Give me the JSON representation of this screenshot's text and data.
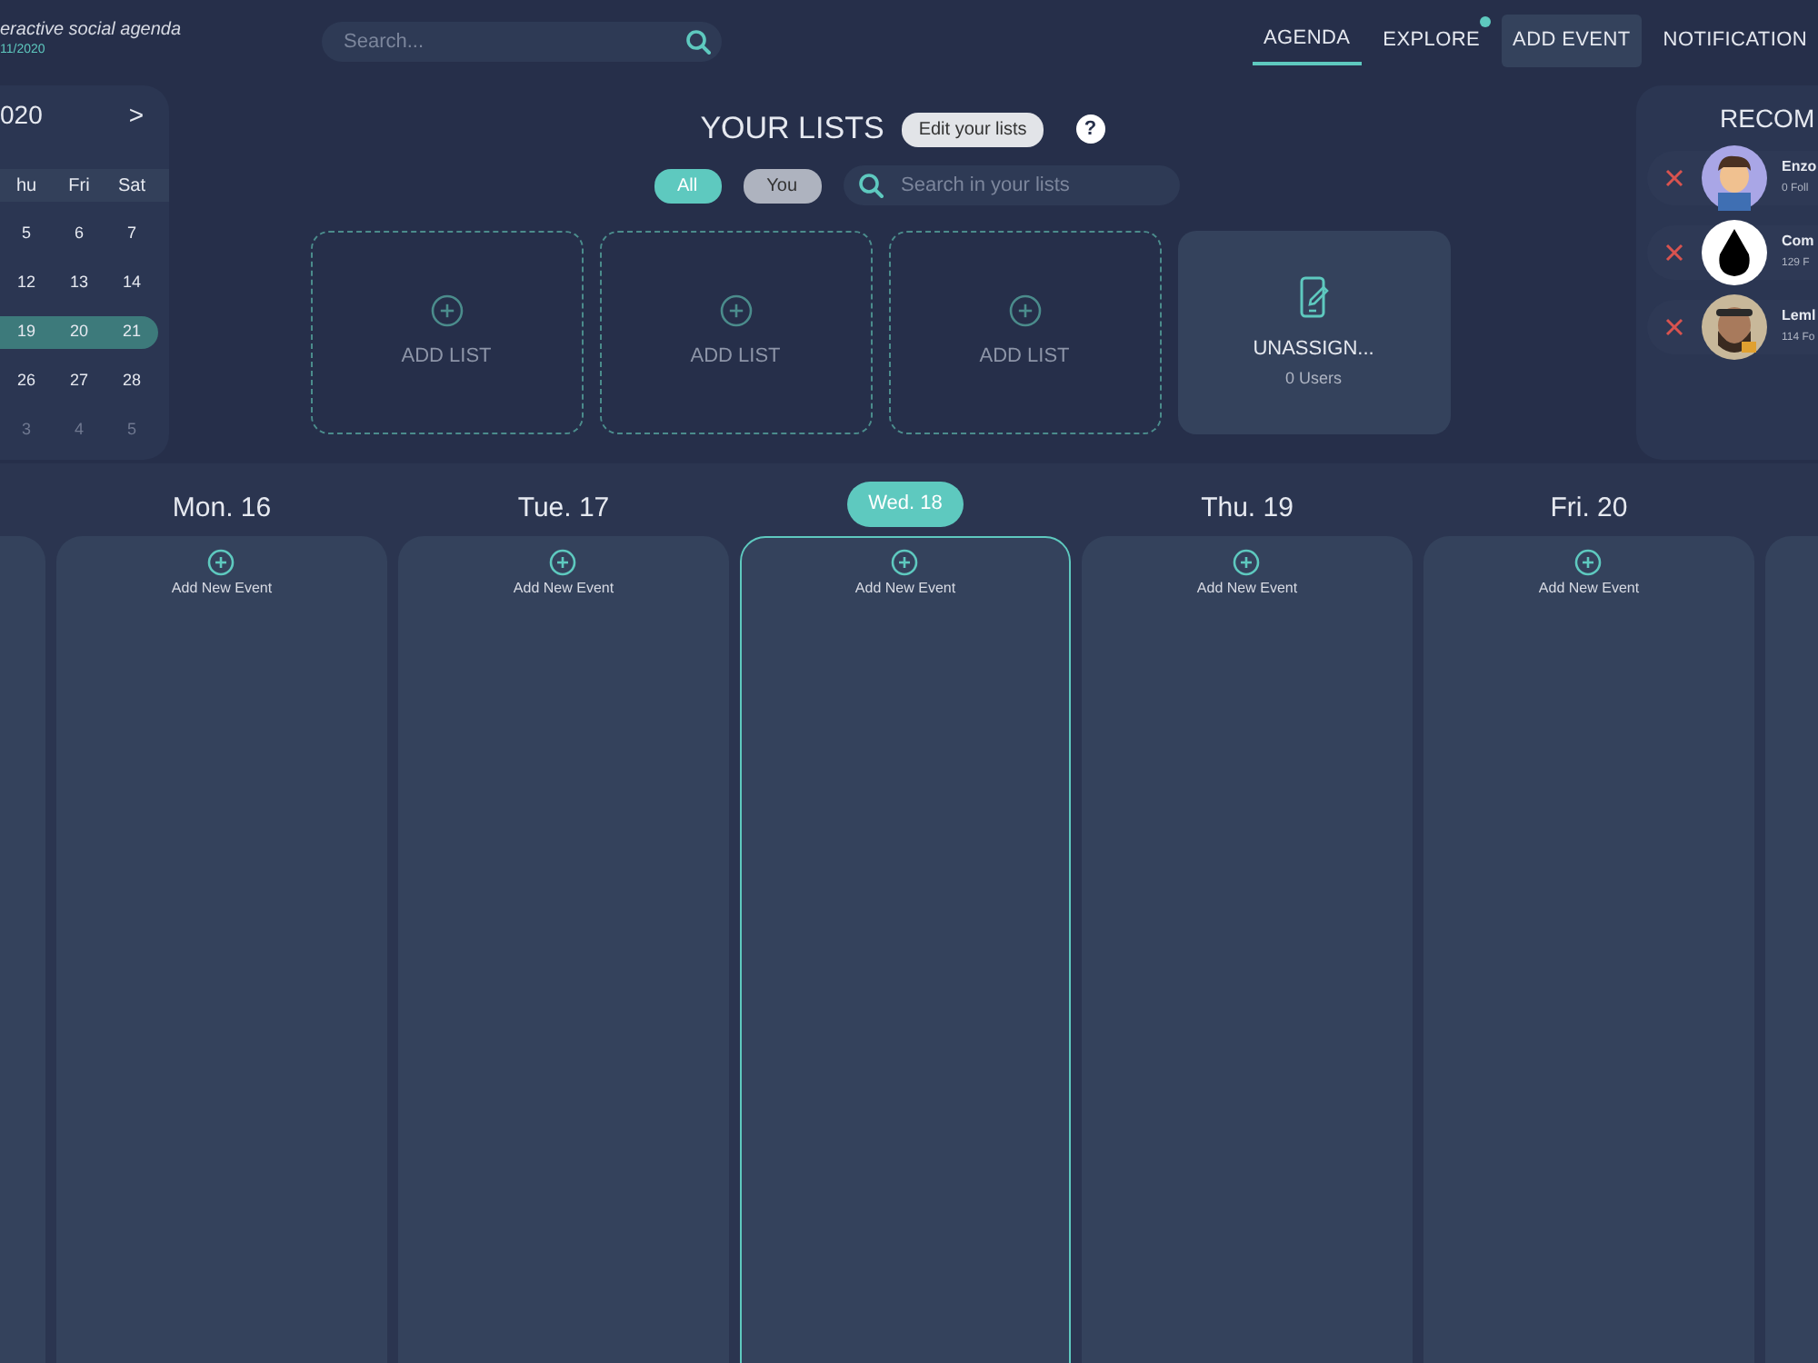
{
  "header": {
    "brand": "eractive social agenda",
    "date": "11/2020",
    "search": {
      "placeholder": "Search..."
    },
    "nav": [
      {
        "label": "AGENDA",
        "selected": true,
        "dot": false,
        "kind": "link"
      },
      {
        "label": "EXPLORE",
        "selected": false,
        "dot": true,
        "kind": "link"
      },
      {
        "label": "ADD EVENT",
        "selected": false,
        "dot": false,
        "kind": "button"
      },
      {
        "label": "NOTIFICATION",
        "selected": false,
        "dot": false,
        "kind": "link"
      }
    ]
  },
  "calendar": {
    "title": "020",
    "next": ">",
    "weekdays": [
      "hu",
      "Fri",
      "Sat"
    ],
    "weeks": [
      {
        "days": [
          "5",
          "6",
          "7"
        ],
        "selected": false,
        "other_month": false
      },
      {
        "days": [
          "12",
          "13",
          "14"
        ],
        "selected": false,
        "other_month": false
      },
      {
        "days": [
          "19",
          "20",
          "21"
        ],
        "selected": true,
        "other_month": false
      },
      {
        "days": [
          "26",
          "27",
          "28"
        ],
        "selected": false,
        "other_month": false
      },
      {
        "days": [
          "3",
          "4",
          "5"
        ],
        "selected": false,
        "other_month": true
      }
    ]
  },
  "lists": {
    "title": "YOUR LISTS",
    "edit": "Edit your lists",
    "help": "?",
    "filters": [
      {
        "label": "All",
        "selected": true
      },
      {
        "label": "You",
        "selected": false
      }
    ],
    "search": {
      "placeholder": "Search in your lists"
    },
    "cards": [
      {
        "kind": "add",
        "label": "ADD LIST"
      },
      {
        "kind": "add",
        "label": "ADD LIST"
      },
      {
        "kind": "add",
        "label": "ADD LIST"
      },
      {
        "kind": "group",
        "label": "UNASSIGN...",
        "count": "0 Users"
      }
    ]
  },
  "recommendations": {
    "title": "RECOM",
    "items": [
      {
        "name": "Enzo",
        "followers": "0 Foll",
        "kind": "cartoon"
      },
      {
        "name": "Com",
        "followers": "129 F",
        "kind": "logo"
      },
      {
        "name": "Leml",
        "followers": "114 Fo"
      }
    ]
  },
  "days": [
    {
      "selected": false
    },
    {
      "label": "Mon. 16",
      "add": "Add New Event",
      "selected": false
    },
    {
      "label": "Tue. 17",
      "add": "Add New Event",
      "selected": false
    },
    {
      "label": "Wed. 18",
      "add": "Add New Event",
      "selected": true
    },
    {
      "label": "Thu. 19",
      "add": "Add New Event",
      "selected": false
    },
    {
      "label": "Fri. 20",
      "add": "Add New Event",
      "selected": false
    },
    {
      "selected": false
    }
  ]
}
